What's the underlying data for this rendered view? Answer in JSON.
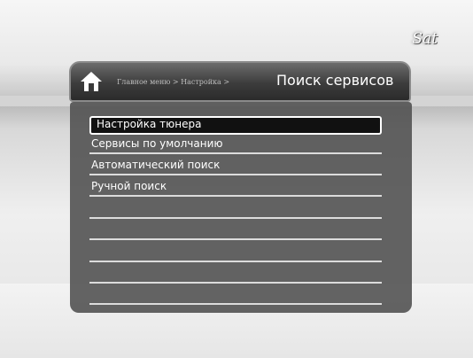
{
  "brand": "Sat",
  "header": {
    "breadcrumb": "Главное меню > Настройка >",
    "title": "Поиск сервисов"
  },
  "menu": {
    "items": [
      {
        "label": "Настройка тюнера",
        "selected": true
      },
      {
        "label": "Сервисы по умолчанию",
        "selected": false
      },
      {
        "label": "Автоматический поиск",
        "selected": false
      },
      {
        "label": "Ручной поиск",
        "selected": false
      },
      {
        "label": "",
        "selected": false
      },
      {
        "label": "",
        "selected": false
      },
      {
        "label": "",
        "selected": false
      },
      {
        "label": "",
        "selected": false
      },
      {
        "label": "",
        "selected": false
      },
      {
        "label": "",
        "selected": false
      }
    ]
  },
  "icons": {
    "home": "home-icon"
  }
}
